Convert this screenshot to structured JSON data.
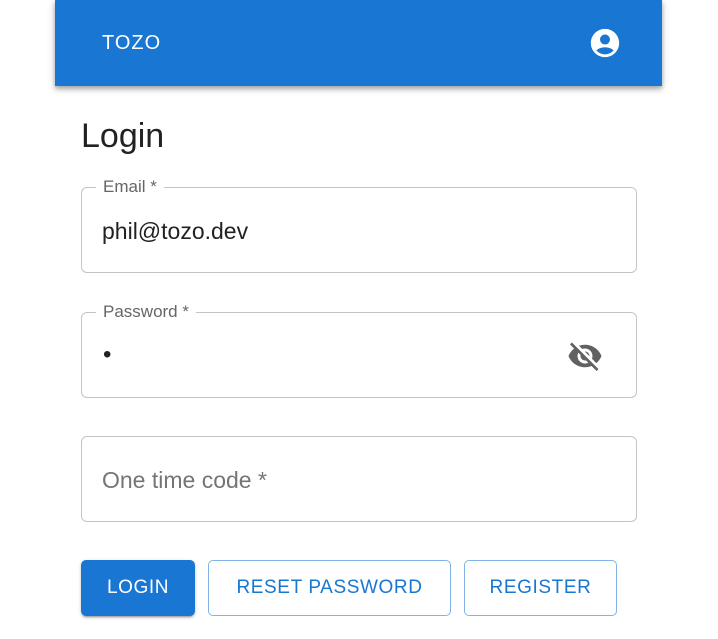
{
  "appbar": {
    "brand": "TOZO",
    "account_icon": "account-circle-icon",
    "color": "#1976d2"
  },
  "page": {
    "title": "Login"
  },
  "form": {
    "email": {
      "label": "Email *",
      "value": "phil@tozo.dev"
    },
    "password": {
      "label": "Password *",
      "value": "•",
      "visibility_icon": "visibility-off-icon"
    },
    "otp": {
      "placeholder": "One time code *",
      "value": ""
    }
  },
  "actions": {
    "login_label": "LOGIN",
    "reset_label": "RESET PASSWORD",
    "register_label": "REGISTER"
  }
}
